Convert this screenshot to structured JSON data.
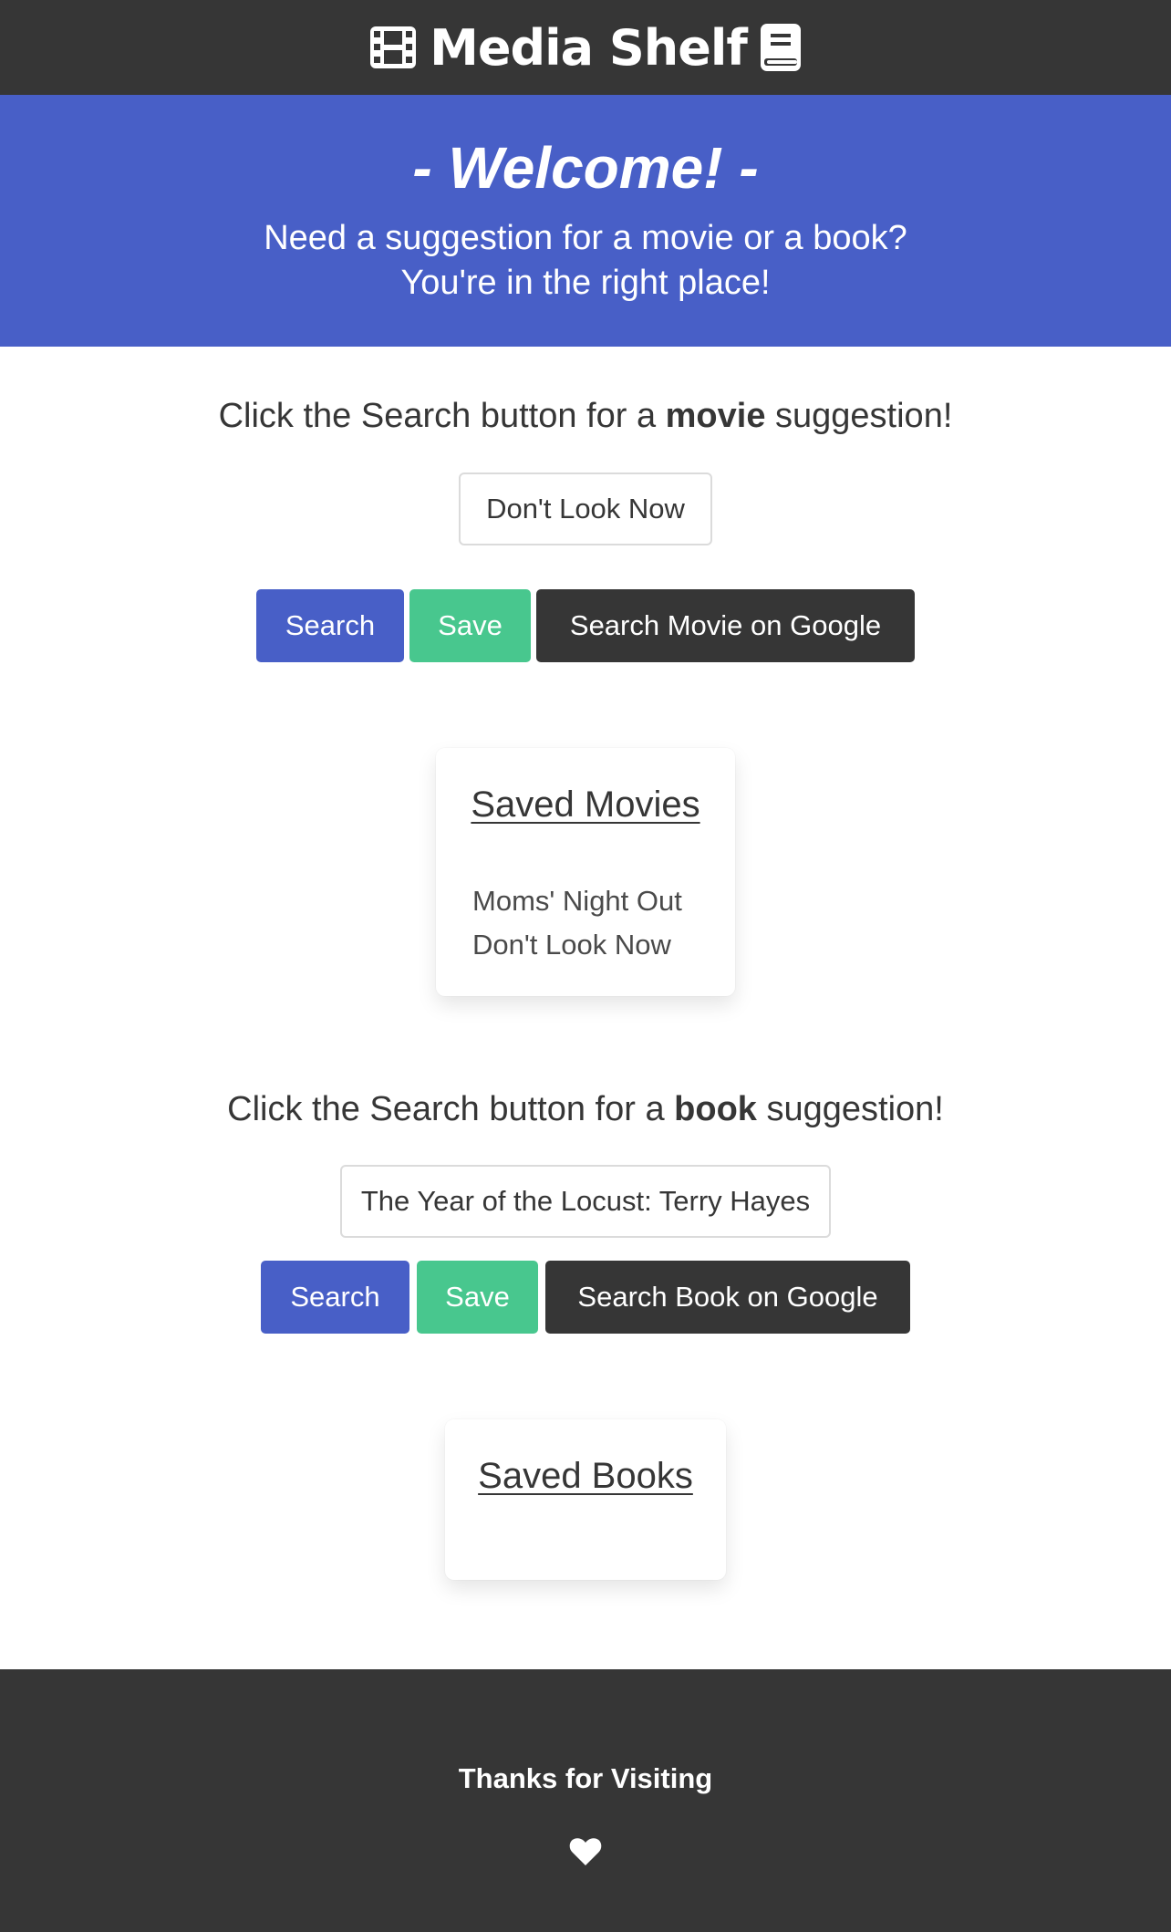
{
  "brand": {
    "title": "Media Shelf",
    "left_icon": "film-icon",
    "right_icon": "book-icon"
  },
  "hero": {
    "welcome": "- Welcome! -",
    "line1": "Need a suggestion for a movie or a book?",
    "line2": "You're in the right place!"
  },
  "movie": {
    "prompt_before": "Click the Search button for a ",
    "prompt_bold": "movie",
    "prompt_after": " suggestion!",
    "result": "Don't Look Now",
    "search_label": "Search",
    "save_label": "Save",
    "google_label": "Search Movie on Google",
    "saved_title": "Saved Movies",
    "saved_items": [
      "Moms' Night Out",
      "Don't Look Now"
    ]
  },
  "book": {
    "prompt_before": "Click the Search button for a ",
    "prompt_bold": "book",
    "prompt_after": " suggestion!",
    "result": "The Year of the Locust: Terry Hayes",
    "search_label": "Search",
    "save_label": "Save",
    "google_label": "Search Book on Google",
    "saved_title": "Saved Books",
    "saved_items": []
  },
  "footer": {
    "thanks": "Thanks for Visiting",
    "icon": "heart-icon"
  },
  "colors": {
    "navbar": "#363636",
    "primary": "#485fc7",
    "success": "#48c78e",
    "dark": "#363636"
  }
}
